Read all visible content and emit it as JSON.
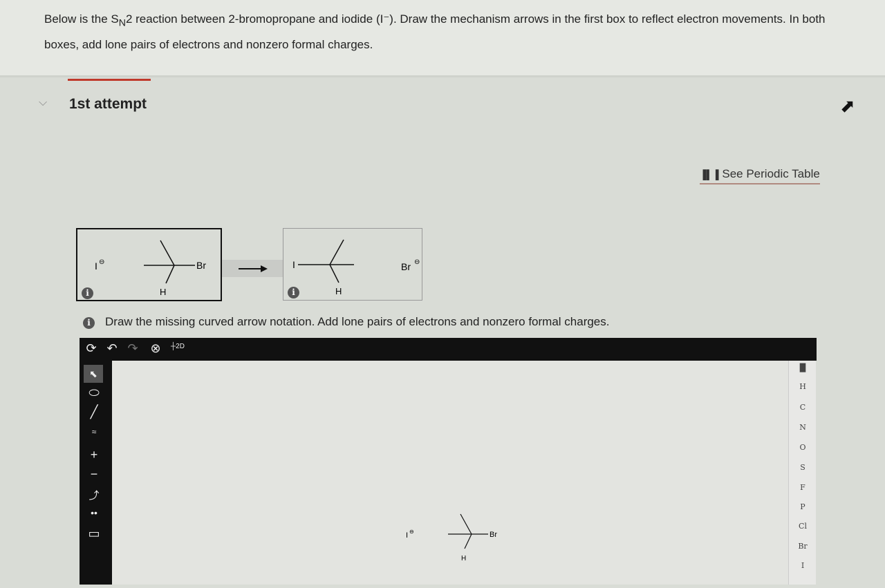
{
  "question": {
    "text_before": "Below is the S",
    "subscript": "N",
    "text_after": "2 reaction between 2-bromopropane and iodide (I⁻). Draw the mechanism arrows in the first box to reflect electron movements. In both boxes, add lone pairs of electrons and nonzero formal charges."
  },
  "attempt": {
    "label": "1st attempt"
  },
  "periodic_table": {
    "label": "See Periodic Table"
  },
  "reaction": {
    "reactant": {
      "iodide": "I",
      "bromine": "Br",
      "hydrogen": "H",
      "charge": "⊖"
    },
    "product": {
      "iodine": "I",
      "bromide": "Br",
      "hydrogen": "H",
      "charge": "⊖"
    }
  },
  "instruction": "Draw the missing curved arrow notation. Add lone pairs of electrons and nonzero formal charges.",
  "info_label": "i",
  "editor": {
    "top_tools": [
      "reset-icon",
      "undo-icon",
      "redo-icon",
      "zoom-clear-icon",
      "2d-icon"
    ],
    "twod_label": "2D",
    "left_tools": [
      "select-icon",
      "eraser-icon",
      "bond-icon",
      "chain-icon",
      "plus-charge-icon",
      "minus-charge-icon",
      "curved-arrow-icon",
      "lone-pair-icon",
      "rectangle-icon"
    ],
    "elements": [
      "H",
      "C",
      "N",
      "O",
      "S",
      "F",
      "P",
      "Cl",
      "Br",
      "I"
    ],
    "canvas": {
      "iodide": "I",
      "bromine": "Br",
      "hydrogen": "H",
      "charge": "⊖"
    }
  }
}
